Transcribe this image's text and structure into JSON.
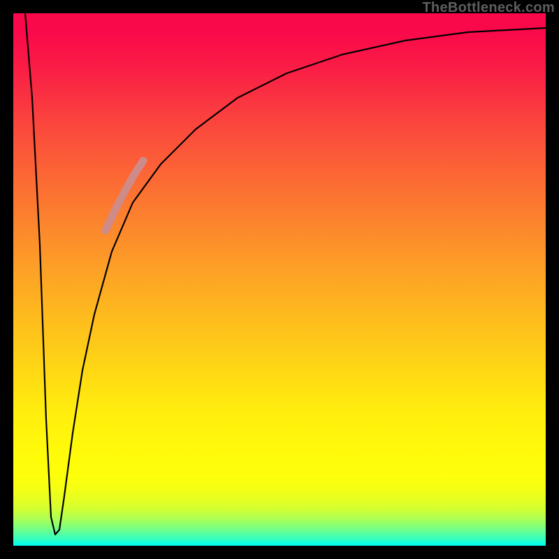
{
  "watermark": "TheBottleneck.com",
  "colors": {
    "frame": "#000000",
    "curve_stroke": "#000000",
    "highlight_stroke": "#cf8b87",
    "gradient_top": "#f9084a",
    "gradient_bottom": "#02fff3"
  },
  "chart_data": {
    "type": "line",
    "title": "",
    "xlabel": "",
    "ylabel": "",
    "xlim": [
      0,
      100
    ],
    "ylim": [
      0,
      100
    ],
    "grid": false,
    "legend": false,
    "note": "Axes have no visible tick labels; values below are heights read relative to plot area (0 = bottom/green, 100 = top/red).",
    "series": [
      {
        "name": "bottleneck-curve",
        "x": [
          0,
          3,
          5,
          7,
          8,
          10,
          12,
          15,
          20,
          25,
          30,
          35,
          40,
          45,
          50,
          55,
          60,
          65,
          70,
          75,
          80,
          85,
          90,
          95,
          100
        ],
        "values": [
          100,
          70,
          30,
          3,
          2,
          15,
          35,
          50,
          62,
          71,
          77,
          82,
          85,
          87.5,
          89.5,
          91,
          92.4,
          93.5,
          94.4,
          95.2,
          95.8,
          96.3,
          96.7,
          97,
          97.2
        ]
      }
    ],
    "highlight_segment": {
      "description": "thicker pale-red segment on rising curve",
      "x_start": 18,
      "x_end": 25,
      "values_start": 59,
      "values_end": 71
    }
  }
}
